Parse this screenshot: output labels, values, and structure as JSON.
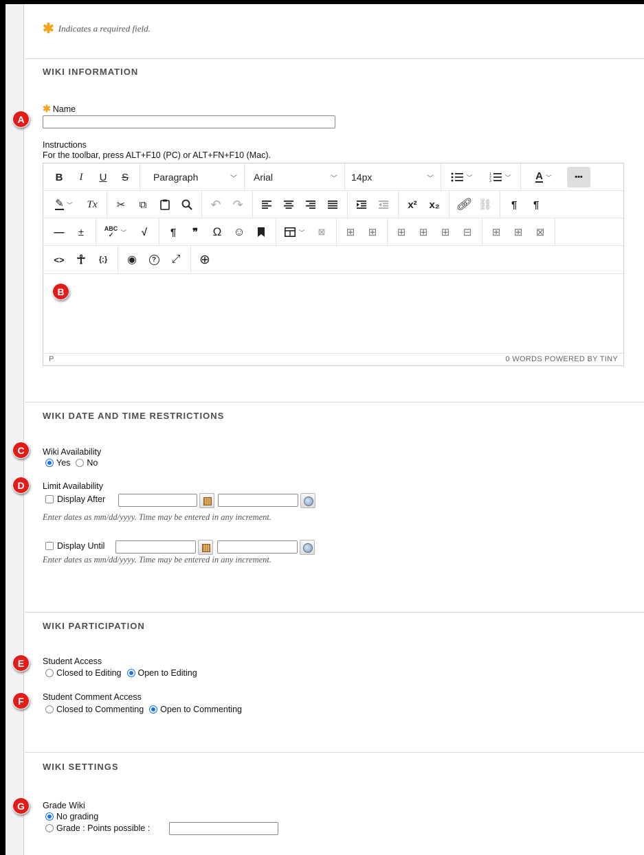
{
  "required_note": "Indicates a required field.",
  "sections": {
    "info": "WIKI INFORMATION",
    "dates": "WIKI DATE AND TIME RESTRICTIONS",
    "participation": "WIKI PARTICIPATION",
    "settings": "WIKI SETTINGS"
  },
  "badges": [
    "A",
    "B",
    "C",
    "D",
    "E",
    "F",
    "G"
  ],
  "name_field": {
    "label": "Name",
    "value": ""
  },
  "instructions": {
    "label": "Instructions",
    "hint": "For the toolbar, press ALT+F10 (PC) or ALT+FN+F10 (Mac)."
  },
  "editor": {
    "block_format": "Paragraph",
    "font_family": "Arial",
    "font_size": "14px",
    "status_left": "P",
    "status_right": "0 WORDS  POWERED BY TINY",
    "toolbar_icons": {
      "bold": "B",
      "italic": "I",
      "underline": "U",
      "strikethrough": "S",
      "more": "•••",
      "text_color": "A",
      "clear_format": "Tx",
      "cut": "✂",
      "copy": "⧉",
      "paste": "📋",
      "find": "⌕",
      "undo": "↶",
      "redo": "↷",
      "superscript": "x²",
      "subscript": "x₂",
      "ltr": "¶",
      "rtl": "¶",
      "hr": "—",
      "add": "±",
      "math": "√",
      "pilcrow": "¶",
      "quote": "❞",
      "omega": "Ω",
      "emoji": "☺",
      "code": "<>",
      "a11y": "☥",
      "mashup": "{;}",
      "preview": "◉",
      "help": "?",
      "fullscreen": "⤢",
      "plus": "⊕"
    }
  },
  "availability": {
    "label": "Wiki Availability",
    "options": [
      {
        "label": "Yes",
        "selected": true
      },
      {
        "label": "No",
        "selected": false
      }
    ]
  },
  "limit": {
    "label": "Limit Availability",
    "after_label": "Display After",
    "until_label": "Display Until",
    "help": "Enter dates as mm/dd/yyyy. Time may be entered in any increment."
  },
  "student_access": {
    "label": "Student Access",
    "options": [
      {
        "label": "Closed to Editing",
        "selected": false
      },
      {
        "label": "Open to Editing",
        "selected": true
      }
    ]
  },
  "comment_access": {
    "label": "Student Comment Access",
    "options": [
      {
        "label": "Closed to Commenting",
        "selected": false
      },
      {
        "label": "Open to Commenting",
        "selected": true
      }
    ]
  },
  "grade": {
    "label": "Grade Wiki",
    "options": [
      {
        "label": "No grading",
        "selected": true
      },
      {
        "label": "Grade : Points possible :",
        "selected": false
      }
    ]
  },
  "colors": {
    "badge": "#e21b1b",
    "required_star": "#f4a31c",
    "radio_selected": "#1a73e8"
  }
}
